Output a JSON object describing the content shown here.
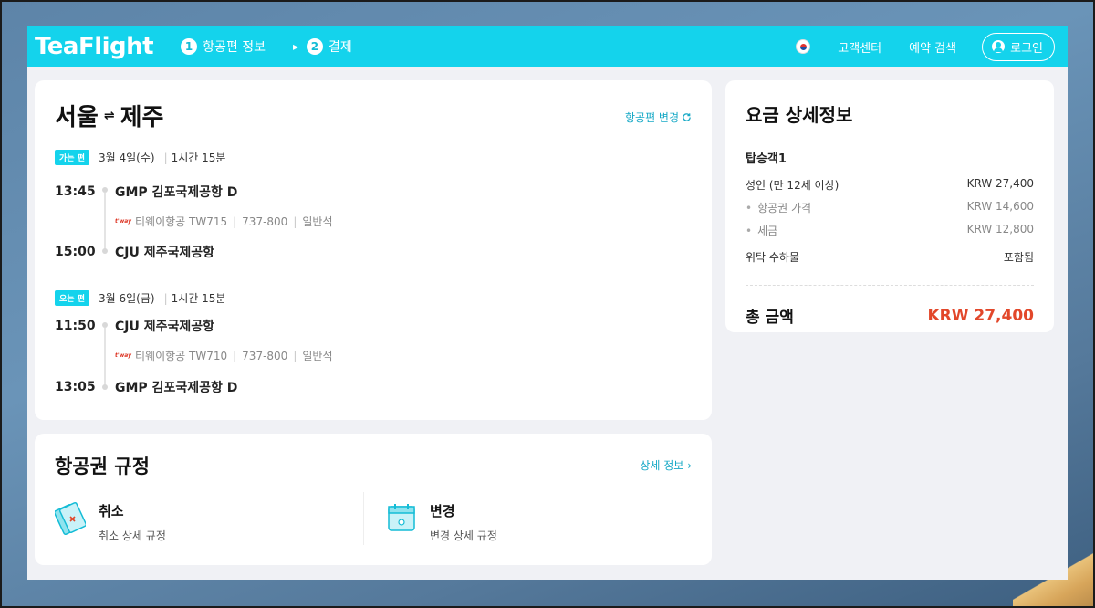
{
  "header": {
    "logo": "TeaFlight",
    "steps": [
      {
        "num": "1",
        "label": "항공편 정보"
      },
      {
        "num": "2",
        "label": "결제"
      }
    ],
    "step_arrow": "------▸",
    "customer_center": "고객센터",
    "booking_search": "예약 검색",
    "login": "로그인"
  },
  "flight": {
    "origin": "서울",
    "swap_symbol": "⇌",
    "destination": "제주",
    "change_link": "항공편 변경",
    "outbound": {
      "badge": "가는 편",
      "date": "3월 4일(수)",
      "duration": "1시간 15분",
      "dep_time": "13:45",
      "dep_airport": "GMP 김포국제공항 D",
      "airline_logo": "t'way",
      "airline": "티웨이항공 TW715",
      "aircraft": "737-800",
      "cabin": "일반석",
      "arr_time": "15:00",
      "arr_airport": "CJU 제주국제공항"
    },
    "return": {
      "badge": "오는 편",
      "date": "3월 6일(금)",
      "duration": "1시간 15분",
      "dep_time": "11:50",
      "dep_airport": "CJU 제주국제공항",
      "airline_logo": "t'way",
      "airline": "티웨이항공 TW710",
      "aircraft": "737-800",
      "cabin": "일반석",
      "arr_time": "13:05",
      "arr_airport": "GMP 김포국제공항 D"
    }
  },
  "rules": {
    "title": "항공권 규정",
    "detail_link": "상세 정보",
    "cancel": {
      "name": "취소",
      "desc": "취소 상세 규정"
    },
    "change": {
      "name": "변경",
      "desc": "변경 상세 규정"
    }
  },
  "fare": {
    "title": "요금 상세정보",
    "passenger": "탑승객1",
    "adult_label": "성인 (만 12세 이상)",
    "adult_value": "KRW 27,400",
    "ticket_label": "항공권 가격",
    "ticket_value": "KRW 14,600",
    "tax_label": "세금",
    "tax_value": "KRW 12,800",
    "baggage_label": "위탁 수하물",
    "baggage_value": "포함됨",
    "total_label": "총 금액",
    "total_value": "KRW 27,400"
  },
  "colors": {
    "brand": "#14d3ec",
    "link": "#17a9c6",
    "total": "#e2472a"
  }
}
